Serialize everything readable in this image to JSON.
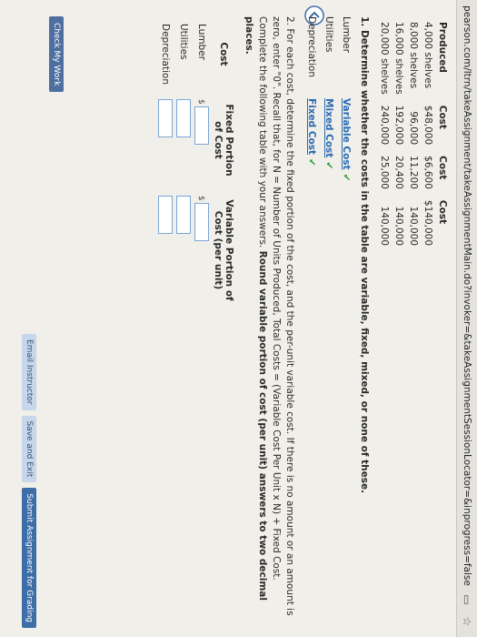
{
  "url": "pearson.com/ltrn/takeAssignment/takeAssignmentMain.do?invoker=&takeAssignmentSessionLocator=&inprogress=false",
  "icons": {
    "star": "star-icon",
    "window": "window-icon",
    "back": "chevron-left-icon"
  },
  "table1": {
    "headers": [
      "Produced",
      "Cost",
      "Cost",
      "Cost"
    ],
    "rows": [
      [
        "4,000 shelves",
        "$48,000",
        "$6,600",
        "$140,000"
      ],
      [
        "8,000 shelves",
        "96,000",
        "11,200",
        "140,000"
      ],
      [
        "16,000 shelves",
        "192,000",
        "20,400",
        "140,000"
      ],
      [
        "20,000 shelves",
        "240,000",
        "25,000",
        "140,000"
      ]
    ]
  },
  "q1": "1. Determine whether the costs in the table are variable, fixed, mixed, or none of these.",
  "classify": [
    {
      "name": "Lumber",
      "value": "Variable Cost"
    },
    {
      "name": "Utilities",
      "value": "Mixed Cost"
    },
    {
      "name": "Depreciation",
      "value": "Fixed Cost"
    }
  ],
  "q2_text": "2. For each cost, determine the fixed portion of the cost, and the per-unit variable cost. If there is no amount or an amount is zero, enter \"0\". Recall that, for N = Number of Units Produced, Total Costs = (Variable Cost Per Unit x N) + Fixed Cost. Complete the following table with your answers.",
  "q2_bold": "Round variable portion of cost (per unit) answers to two decimal places.",
  "table2": {
    "h_cost": "Cost",
    "h_fixed": "Fixed Portion of Cost",
    "h_var": "Variable Portion of Cost (per unit)",
    "rows": [
      "Lumber",
      "Utilities",
      "Depreciation"
    ],
    "dollar": "$"
  },
  "check_work": "Check My Work",
  "buttons": {
    "email": "Email Instructor",
    "save": "Save and Exit",
    "submit": "Submit Assignment for Grading"
  },
  "checkmark": "✔"
}
